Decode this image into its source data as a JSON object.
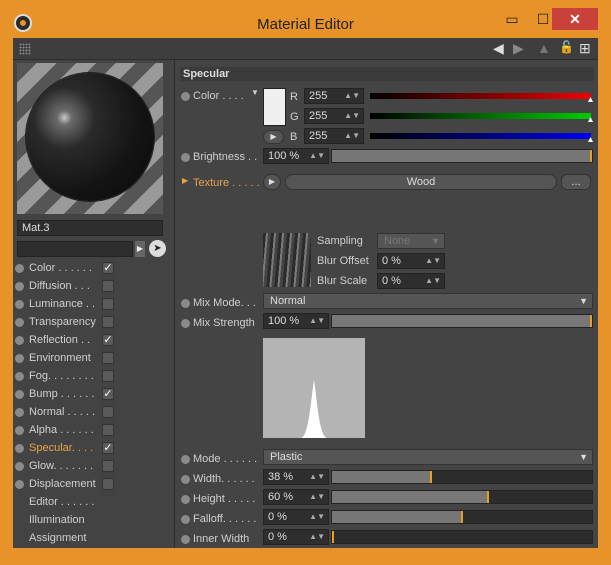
{
  "window": {
    "title": "Material Editor",
    "min": "▭",
    "max": "☐",
    "close": "✕"
  },
  "toolbar": {
    "back_icon": "◀",
    "fwd_icon": "▶",
    "pin_icon": "▲",
    "lock_icon": "🔓",
    "add_icon": "⊞"
  },
  "material": {
    "name": "Mat.3"
  },
  "channels": [
    {
      "label": "Color . . . . . .",
      "checked": "✓"
    },
    {
      "label": "Diffusion . . .",
      "checked": ""
    },
    {
      "label": "Luminance . .",
      "checked": ""
    },
    {
      "label": "Transparency",
      "checked": ""
    },
    {
      "label": "Reflection . .",
      "checked": "✓"
    },
    {
      "label": "Environment",
      "checked": ""
    },
    {
      "label": "Fog. . . . . . . .",
      "checked": ""
    },
    {
      "label": "Bump . . . . . .",
      "checked": "✓"
    },
    {
      "label": "Normal . . . . .",
      "checked": ""
    },
    {
      "label": "Alpha . . . . . .",
      "checked": ""
    },
    {
      "label": "Specular. . . .",
      "checked": "✓"
    },
    {
      "label": "Glow. . . . . . .",
      "checked": ""
    },
    {
      "label": "Displacement",
      "checked": ""
    }
  ],
  "extra_items": [
    "Editor . . . . . .",
    "Illumination",
    "Assignment"
  ],
  "specular": {
    "section_title": "Specular",
    "color_label": "Color . . . .",
    "r_label": "R",
    "g_label": "G",
    "b_label": "B",
    "r": "255",
    "g": "255",
    "b": "255",
    "brightness_label": "Brightness . .",
    "brightness": "100 %",
    "texture_label": "Texture . . . . .",
    "texture_name": "Wood",
    "texture_more": "...",
    "sampling_label": "Sampling",
    "sampling": "None",
    "blur_offset_label": "Blur Offset",
    "blur_offset": "0 %",
    "blur_scale_label": "Blur Scale",
    "blur_scale": "0 %",
    "mix_mode_label": "Mix Mode. . .",
    "mix_mode": "Normal",
    "mix_strength_label": "Mix Strength",
    "mix_strength": "100 %",
    "mode_label": "Mode . . . . . .",
    "mode": "Plastic",
    "width_label": "Width. . . . . .",
    "width": "38 %",
    "width_frac": 0.38,
    "height_label": "Height . . . . .",
    "height": "60 %",
    "height_frac": 0.6,
    "falloff_label": "Falloff. . . . . .",
    "falloff": "0 %",
    "falloff_frac": 0.5,
    "inner_width_label": "Inner Width",
    "inner_width": "0 %",
    "inner_width_frac": 0.0
  },
  "colors": {
    "accent": "#e8922a",
    "close": "#c9413a",
    "knob": "#e8a020"
  }
}
